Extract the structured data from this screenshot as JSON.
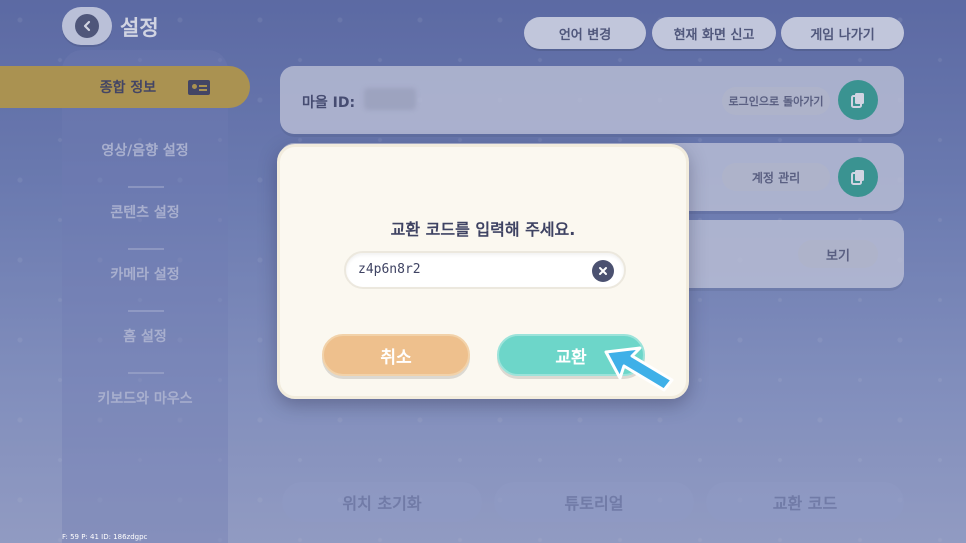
{
  "header": {
    "title": "설정",
    "back_icon": "chevron-left-icon"
  },
  "top_buttons": {
    "language": "언어 변경",
    "report": "현재 화면 신고",
    "exit": "게임 나가기"
  },
  "sidebar": {
    "items": [
      {
        "label": "종합 정보",
        "active": true,
        "icon": "id-card-icon"
      },
      {
        "label": "영상/음향 설정"
      },
      {
        "label": "콘텐츠 설정"
      },
      {
        "label": "카메라 설정"
      },
      {
        "label": "홈 설정"
      },
      {
        "label": "키보드와 마우스"
      }
    ]
  },
  "main": {
    "village_id_label": "마을 ID:",
    "return_login_label": "로그인으로 돌아가기",
    "account_manage_label": "계정 관리",
    "view_label": "보기"
  },
  "bottom_buttons": {
    "reset_position": "위치 초기화",
    "tutorial": "튜토리얼",
    "exchange_code": "교환 코드"
  },
  "footer": {
    "text": "F: 59    P: 41    ID: 186zdgpc"
  },
  "modal": {
    "message": "교환 코드를 입력해 주세요.",
    "code_value": "z4p6n8r2",
    "cancel_label": "취소",
    "confirm_label": "교환"
  },
  "colors": {
    "accent_teal": "#6dd6c9",
    "cancel_orange": "#eec08d",
    "active_gold": "#c9a437",
    "copy_green": "#2fa58f"
  }
}
